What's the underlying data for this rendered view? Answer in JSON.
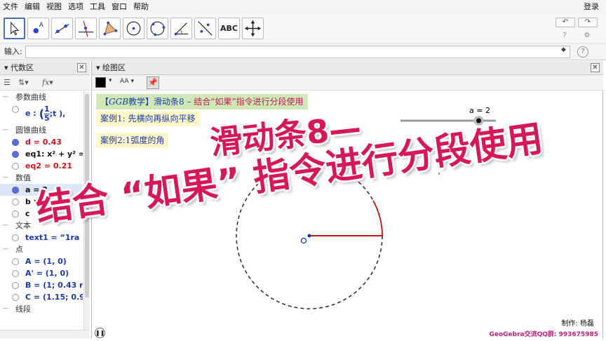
{
  "menu": [
    "文件",
    "编辑",
    "视图",
    "选项",
    "工具",
    "窗口",
    "帮助"
  ],
  "login": "登录",
  "toolbar": {
    "text_tool_label": "ABC"
  },
  "input": {
    "label": "输入:",
    "value": ""
  },
  "algebra": {
    "title": "代数区",
    "rows": [
      {
        "kind": "cat",
        "text": "参数曲线"
      },
      {
        "kind": "obj",
        "text": "e :",
        "color": "#1a3aa8",
        "dot": "off",
        "extra": "frac"
      },
      {
        "kind": "cat",
        "text": "圆锥曲线"
      },
      {
        "kind": "obj",
        "text": "d = 0.43",
        "color": "#d0101a",
        "dot": "on"
      },
      {
        "kind": "obj",
        "text": "eq1: x² + y² =",
        "color": "#111111",
        "dot": "on"
      },
      {
        "kind": "obj",
        "text": "eq2 = 0.21",
        "color": "#d0101a",
        "dot": "off"
      },
      {
        "kind": "cat",
        "text": "数值"
      },
      {
        "kind": "obj",
        "text": "a = 2",
        "color": "#111111",
        "dot": "on",
        "selected": true
      },
      {
        "kind": "obj",
        "text": "b :",
        "color": "#111111",
        "dot": "off"
      },
      {
        "kind": "obj",
        "text": "c",
        "color": "#111111",
        "dot": "off"
      },
      {
        "kind": "cat",
        "text": "文本"
      },
      {
        "kind": "obj",
        "text": "text1 = “1ra",
        "color": "#1a3aa8",
        "dot": "off"
      },
      {
        "kind": "cat",
        "text": "点"
      },
      {
        "kind": "obj",
        "text": "A = (1, 0)",
        "color": "#1a3aa8",
        "dot": "off"
      },
      {
        "kind": "obj",
        "text": "A' = (1, 0)",
        "color": "#1a3aa8",
        "dot": "off"
      },
      {
        "kind": "obj",
        "text": "B = (1; 0.43 ra",
        "color": "#1a3aa8",
        "dot": "off"
      },
      {
        "kind": "obj",
        "text": "C = (1.15; 0.95",
        "color": "#1a3aa8",
        "dot": "off"
      },
      {
        "kind": "cat",
        "text": "线段"
      }
    ],
    "frac": {
      "num": "1",
      "den": "5",
      "tail": ";t ),"
    }
  },
  "graphics": {
    "title": "绘图区",
    "font_size_label": "AA",
    "banner_prefix": "【",
    "banner_ggb": "GGB",
    "banner_mid": "教学】滑动条8 – ",
    "banner_pink": "结合“如果”指令进行分段使用",
    "case1": "案例1:  先横向再纵向平移",
    "case2": "案例2:1弧度的角",
    "slider_label": "a = 2",
    "slider_value_fraction": 0.82,
    "overlay_line1": "滑动条8—",
    "overlay_line2": "结合 “如果” 指令进行分段使用",
    "credit": "制作: 杨磊",
    "qq": "GeoGebra交流QQ群: 993675985",
    "colors": {
      "arc": "#c81414",
      "circle": "#333333",
      "point": "#1a3aa8",
      "overlay": "#d61858"
    }
  }
}
